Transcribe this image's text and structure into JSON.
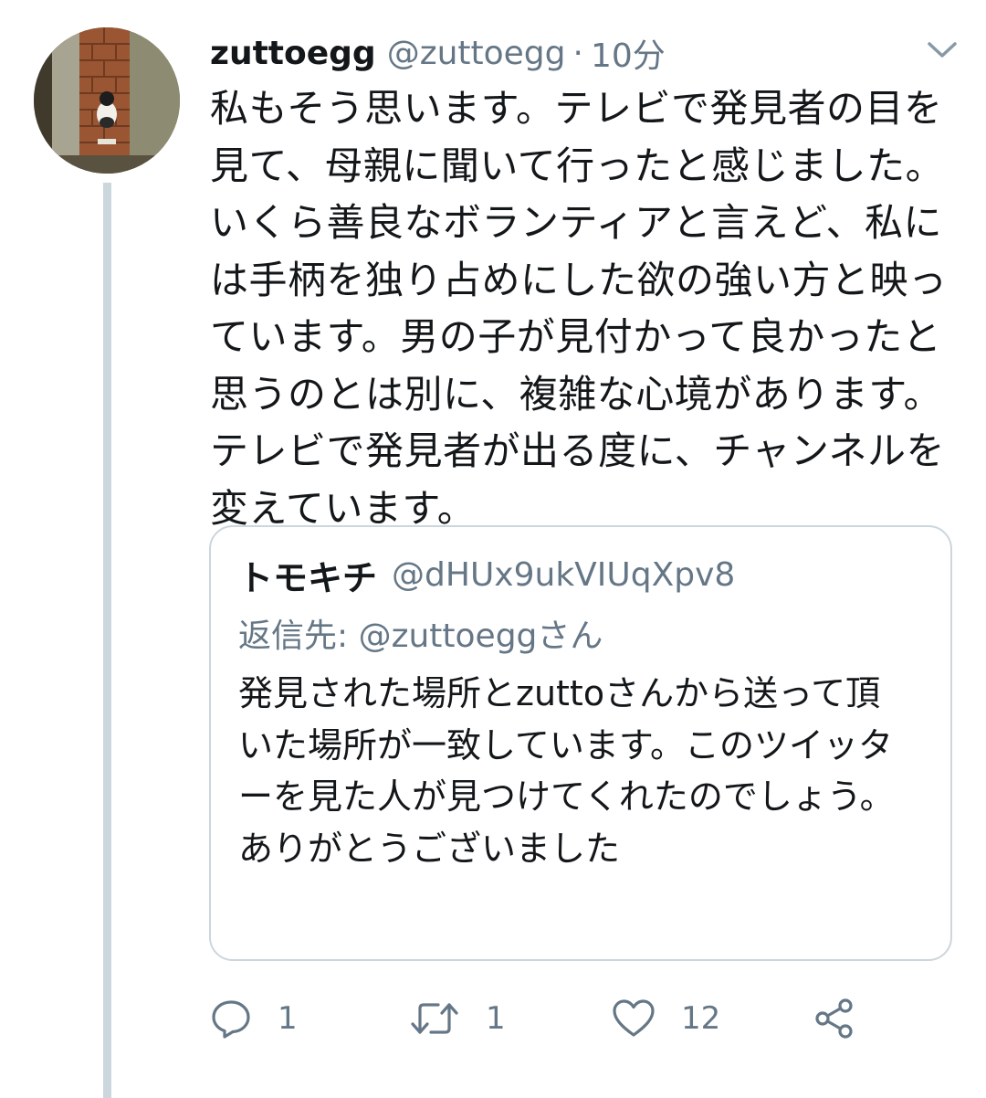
{
  "tweet": {
    "display_name": "zuttoegg",
    "handle": "@zuttoegg",
    "separator": "·",
    "time": "10分",
    "avatar_icon": "cat-photo-avatar",
    "menu_icon": "chevron-down-icon",
    "text": "私もそう思います。テレビで発見者の目を見て、母親に聞いて行ったと感じました。いくら善良なボランティアと言えど、私には手柄を独り占めにした欲の強い方と映っています。男の子が見付かって良かったと思うのとは別に、複雑な心境があります。テレビで発見者が出る度に、チャンネルを変えています。"
  },
  "quote": {
    "display_name": "トモキチ",
    "handle": "@dHUx9ukVIUqXpv8",
    "reply_to": "返信先: @zuttoeggさん",
    "text": "発見された場所とzuttoさんから送って頂いた場所が一致しています。このツイッターを見た人が見つけてくれたのでしょう。ありがとうございました"
  },
  "actions": {
    "reply": {
      "icon": "reply-icon",
      "count": "1"
    },
    "retweet": {
      "icon": "retweet-icon",
      "count": "1"
    },
    "like": {
      "icon": "heart-icon",
      "count": "12"
    },
    "share": {
      "icon": "share-icon"
    }
  },
  "colors": {
    "text": "#14171a",
    "secondary": "#657786",
    "border": "#ccd6dd",
    "background": "#ffffff"
  }
}
